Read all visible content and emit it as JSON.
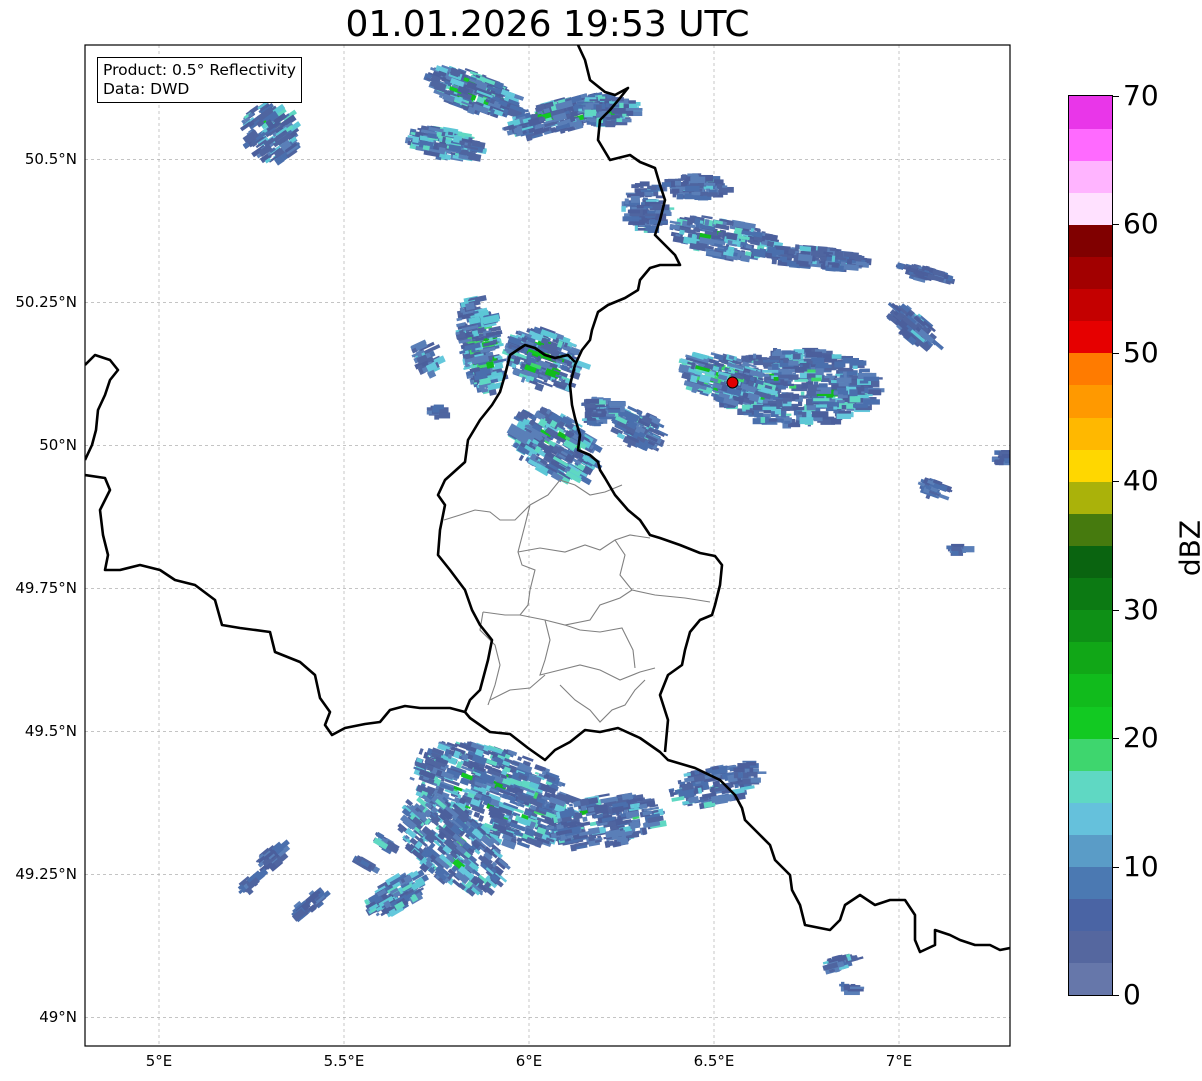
{
  "title": "01.01.2026 19:53 UTC",
  "info": {
    "product": "Product: 0.5° Reflectivity",
    "data": "Data: DWD"
  },
  "map": {
    "lon_range": [
      4.8,
      7.3
    ],
    "lat_range": [
      48.95,
      50.7
    ],
    "lat_ticks": [
      {
        "value": 50.5,
        "label": "50.5°N"
      },
      {
        "value": 50.25,
        "label": "50.25°N"
      },
      {
        "value": 50.0,
        "label": "50°N"
      },
      {
        "value": 49.75,
        "label": "49.75°N"
      },
      {
        "value": 49.5,
        "label": "49.5°N"
      },
      {
        "value": 49.25,
        "label": "49.25°N"
      },
      {
        "value": 49.0,
        "label": "49°N"
      }
    ],
    "lon_ticks": [
      {
        "value": 5.0,
        "label": "5°E"
      },
      {
        "value": 5.5,
        "label": "5.5°E"
      },
      {
        "value": 6.0,
        "label": "6°E"
      },
      {
        "value": 6.5,
        "label": "6.5°E"
      },
      {
        "value": 7.0,
        "label": "7°E"
      }
    ],
    "radar_site": {
      "lon": 6.55,
      "lat": 50.11
    }
  },
  "colorbar": {
    "unit": "dBZ",
    "min": 0,
    "max": 70,
    "ticks": [
      0,
      10,
      20,
      30,
      40,
      50,
      60,
      70
    ],
    "colors": [
      "#6677aa",
      "#55679f",
      "#4a64a4",
      "#4b79b2",
      "#5a9cc7",
      "#65c1dc",
      "#5fd8c3",
      "#3ed66e",
      "#12c922",
      "#11bb1c",
      "#11a717",
      "#0e9016",
      "#0c7a13",
      "#0a6410",
      "#467a0e",
      "#aab20a",
      "#ffd700",
      "#ffb800",
      "#ff9900",
      "#ff7b00",
      "#e60000",
      "#c40000",
      "#a20000",
      "#800000",
      "#ffe1ff",
      "#ffb4ff",
      "#ff6aff",
      "#e936e9"
    ]
  }
}
